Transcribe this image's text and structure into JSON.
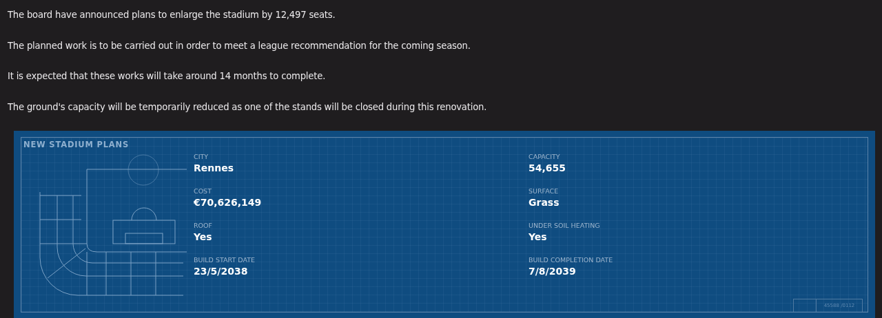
{
  "paragraphs": [
    "The board have announced plans to enlarge the stadium by 12,497 seats.",
    "The planned work is to be carried out in order to meet a league recommendation for the coming season.",
    "It is expected that these works will take around 14 months to complete.",
    "The ground's capacity will be temporarily reduced as one of the stands will be closed during this renovation."
  ],
  "panel": {
    "title": "NEW STADIUM PLANS",
    "fields": [
      {
        "label": "CITY",
        "value": "Rennes"
      },
      {
        "label": "CAPACITY",
        "value": "54,655"
      },
      {
        "label": "COST",
        "value": "€70,626,149"
      },
      {
        "label": "SURFACE",
        "value": "Grass"
      },
      {
        "label": "ROOF",
        "value": "Yes"
      },
      {
        "label": "UNDER SOIL HEATING",
        "value": "Yes"
      },
      {
        "label": "BUILD START DATE",
        "value": "23/5/2038"
      },
      {
        "label": "BUILD COMPLETION DATE",
        "value": "7/8/2039"
      }
    ],
    "stamp": "45588 /0112"
  }
}
